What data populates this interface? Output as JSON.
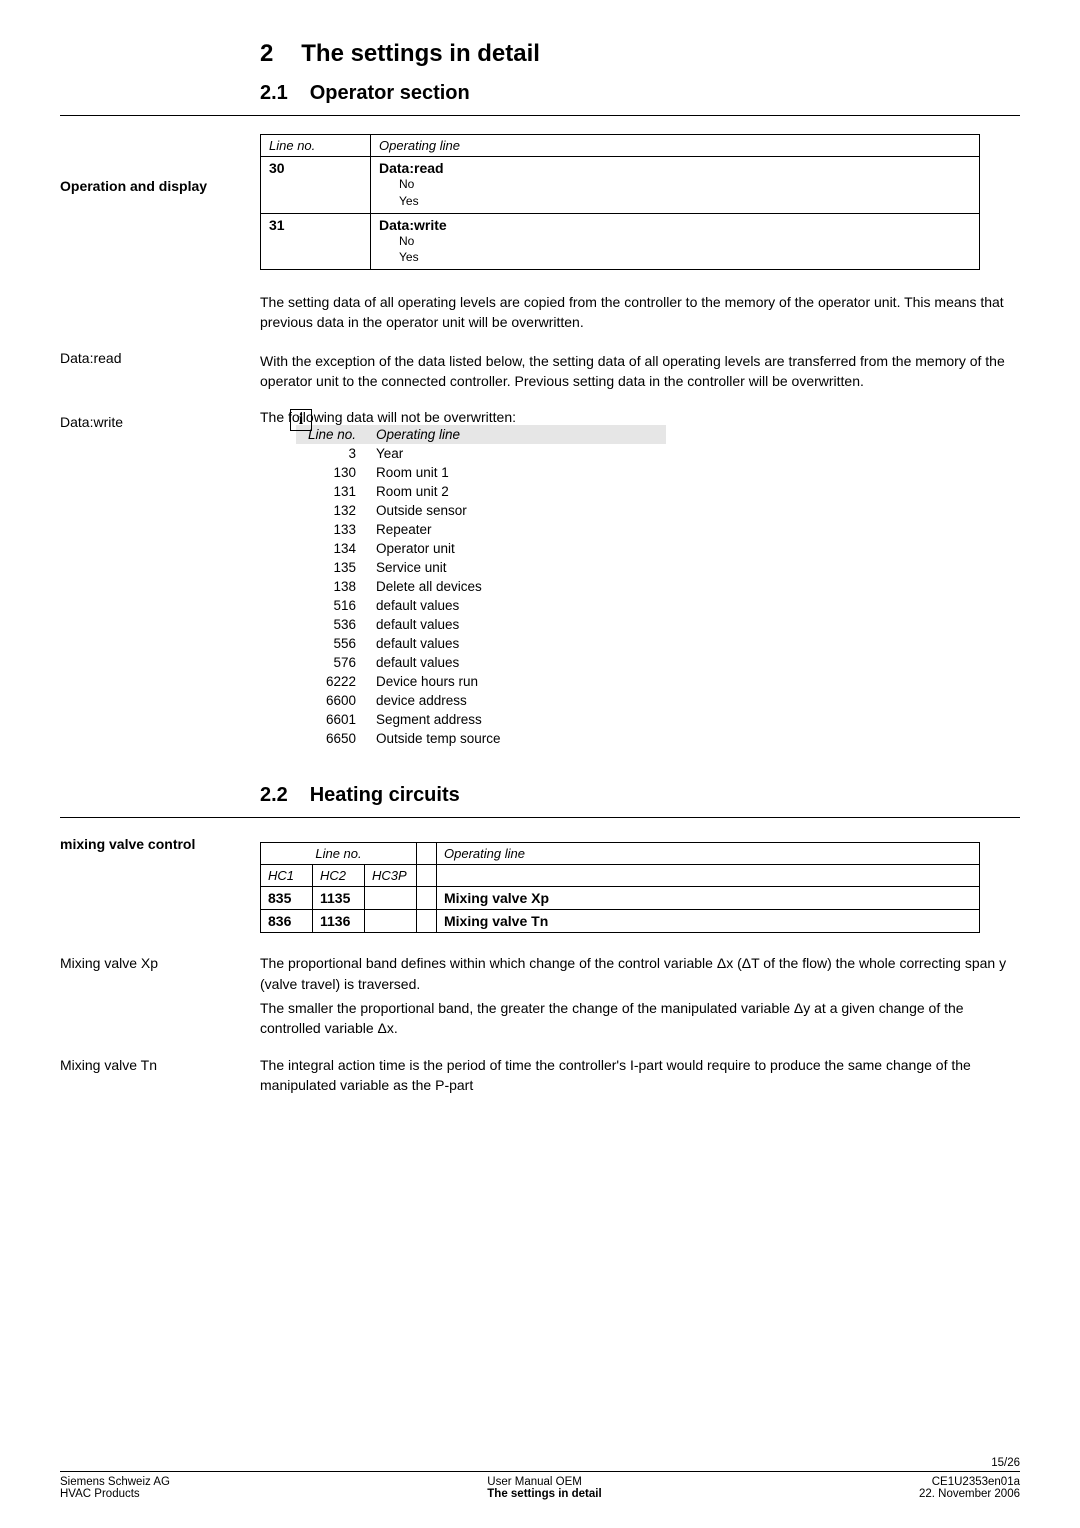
{
  "chapter": {
    "num": "2",
    "title": "The settings in detail"
  },
  "sec21": {
    "num": "2.1",
    "title": "Operator section"
  },
  "sec22": {
    "num": "2.2",
    "title": "Heating circuits"
  },
  "sidelabels": {
    "op_display": "Operation and display",
    "data_read": "Data:read",
    "data_write": "Data:write",
    "mixing_ctrl": "mixing valve control",
    "mix_xp": "Mixing valve Xp",
    "mix_tn": "Mixing valve Tn"
  },
  "table1": {
    "h1": "Line no.",
    "h2": "Operating line",
    "r1c1": "30",
    "r1c2": "Data:read",
    "r1s1": "No",
    "r1s2": "Yes",
    "r2c1": "31",
    "r2c2": "Data:write",
    "r2s1": "No",
    "r2s2": "Yes"
  },
  "para": {
    "read": "The setting data of all operating levels are copied from the controller to the memory of the operator unit. This means that previous data in the operator unit will be overwritten.",
    "write": "With the exception of the data listed below, the setting data of all operating levels are transferred from the memory of the operator unit to the connected controller. Previous setting data in the controller will be overwritten.",
    "overw_intro": "The following data will not be overwritten:",
    "xp1": "The proportional band defines within which change of the control variable Δx (ΔT of the flow) the whole correcting span y (valve travel) is traversed.",
    "xp2": "The smaller the proportional band, the greater the change of the manipulated variable Δy at a given change of the controlled variable Δx.",
    "tn": "The integral action time is the period of time the controller's I-part would require to produce the same change of the manipulated variable as the P-part"
  },
  "overw": {
    "h1": "Line no.",
    "h2": "Operating line",
    "rows": [
      {
        "ln": "3",
        "op": "Year"
      },
      {
        "ln": "130",
        "op": "Room unit 1"
      },
      {
        "ln": "131",
        "op": "Room unit 2"
      },
      {
        "ln": "132",
        "op": "Outside sensor"
      },
      {
        "ln": "133",
        "op": "Repeater"
      },
      {
        "ln": "134",
        "op": "Operator unit"
      },
      {
        "ln": "135",
        "op": "Service unit"
      },
      {
        "ln": "138",
        "op": "Delete all devices"
      },
      {
        "ln": "516",
        "op": "default values"
      },
      {
        "ln": "536",
        "op": "default values"
      },
      {
        "ln": "556",
        "op": "default values"
      },
      {
        "ln": "576",
        "op": "default values"
      },
      {
        "ln": "6222",
        "op": "Device hours run"
      },
      {
        "ln": "6600",
        "op": "device address"
      },
      {
        "ln": "6601",
        "op": "Segment address"
      },
      {
        "ln": "6650",
        "op": "Outside temp source"
      }
    ]
  },
  "table2": {
    "grp": "Line no.",
    "hop": "Operating line",
    "hc1": "HC1",
    "hc2": "HC2",
    "hc3p": "HC3P",
    "r1a": "835",
    "r1b": "1135",
    "r1op": "Mixing valve Xp",
    "r2a": "836",
    "r2b": "1136",
    "r2op": "Mixing valve Tn"
  },
  "footer": {
    "page": "15/26",
    "l1": "Siemens Schweiz AG",
    "l2": "HVAC Products",
    "c1": "User Manual OEM",
    "c2": "The settings in detail",
    "r1": "CE1U2353en01a",
    "r2": "22. November 2006"
  }
}
